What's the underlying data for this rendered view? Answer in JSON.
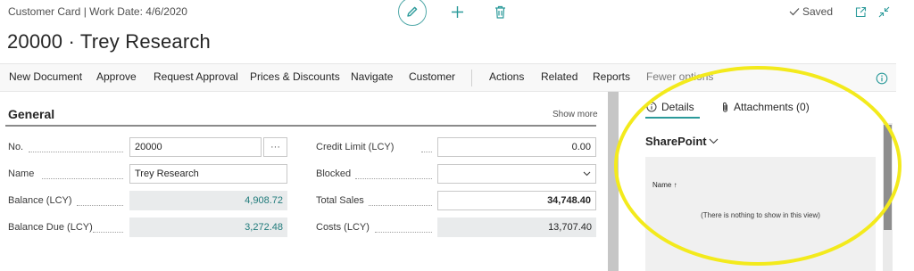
{
  "header": {
    "breadcrumb": "Customer Card | Work Date: 4/6/2020",
    "title": "20000 · Trey Research",
    "saved_label": "Saved"
  },
  "action_bar": {
    "items": [
      "New Document",
      "Approve",
      "Request Approval",
      "Prices & Discounts",
      "Navigate",
      "Customer",
      "Actions",
      "Related",
      "Reports",
      "Fewer options"
    ]
  },
  "general": {
    "title": "General",
    "show_more": "Show more",
    "fields_left": [
      {
        "label": "No.",
        "value": "20000"
      },
      {
        "label": "Name",
        "value": "Trey Research"
      },
      {
        "label": "Balance (LCY)",
        "value": "4,908.72"
      },
      {
        "label": "Balance Due (LCY)",
        "value": "3,272.48"
      }
    ],
    "ellipsis_label": "···",
    "fields_right": [
      {
        "label": "Credit Limit (LCY)",
        "value": "0.00"
      },
      {
        "label": "Blocked",
        "value": ""
      },
      {
        "label": "Total Sales",
        "value": "34,748.40"
      },
      {
        "label": "Costs (LCY)",
        "value": "13,707.40"
      }
    ]
  },
  "factbox": {
    "tabs": [
      {
        "label": "Details",
        "icon": "info-icon"
      },
      {
        "label": "Attachments (0)",
        "icon": "paperclip-icon"
      }
    ],
    "sharepoint_title": "SharePoint",
    "column_header": "Name ↑",
    "empty_message": "(There is nothing to show in this view)"
  },
  "colors": {
    "accent": "#2b9a9a",
    "highlight": "#f3ea1c",
    "link": "#1f7a7a"
  }
}
